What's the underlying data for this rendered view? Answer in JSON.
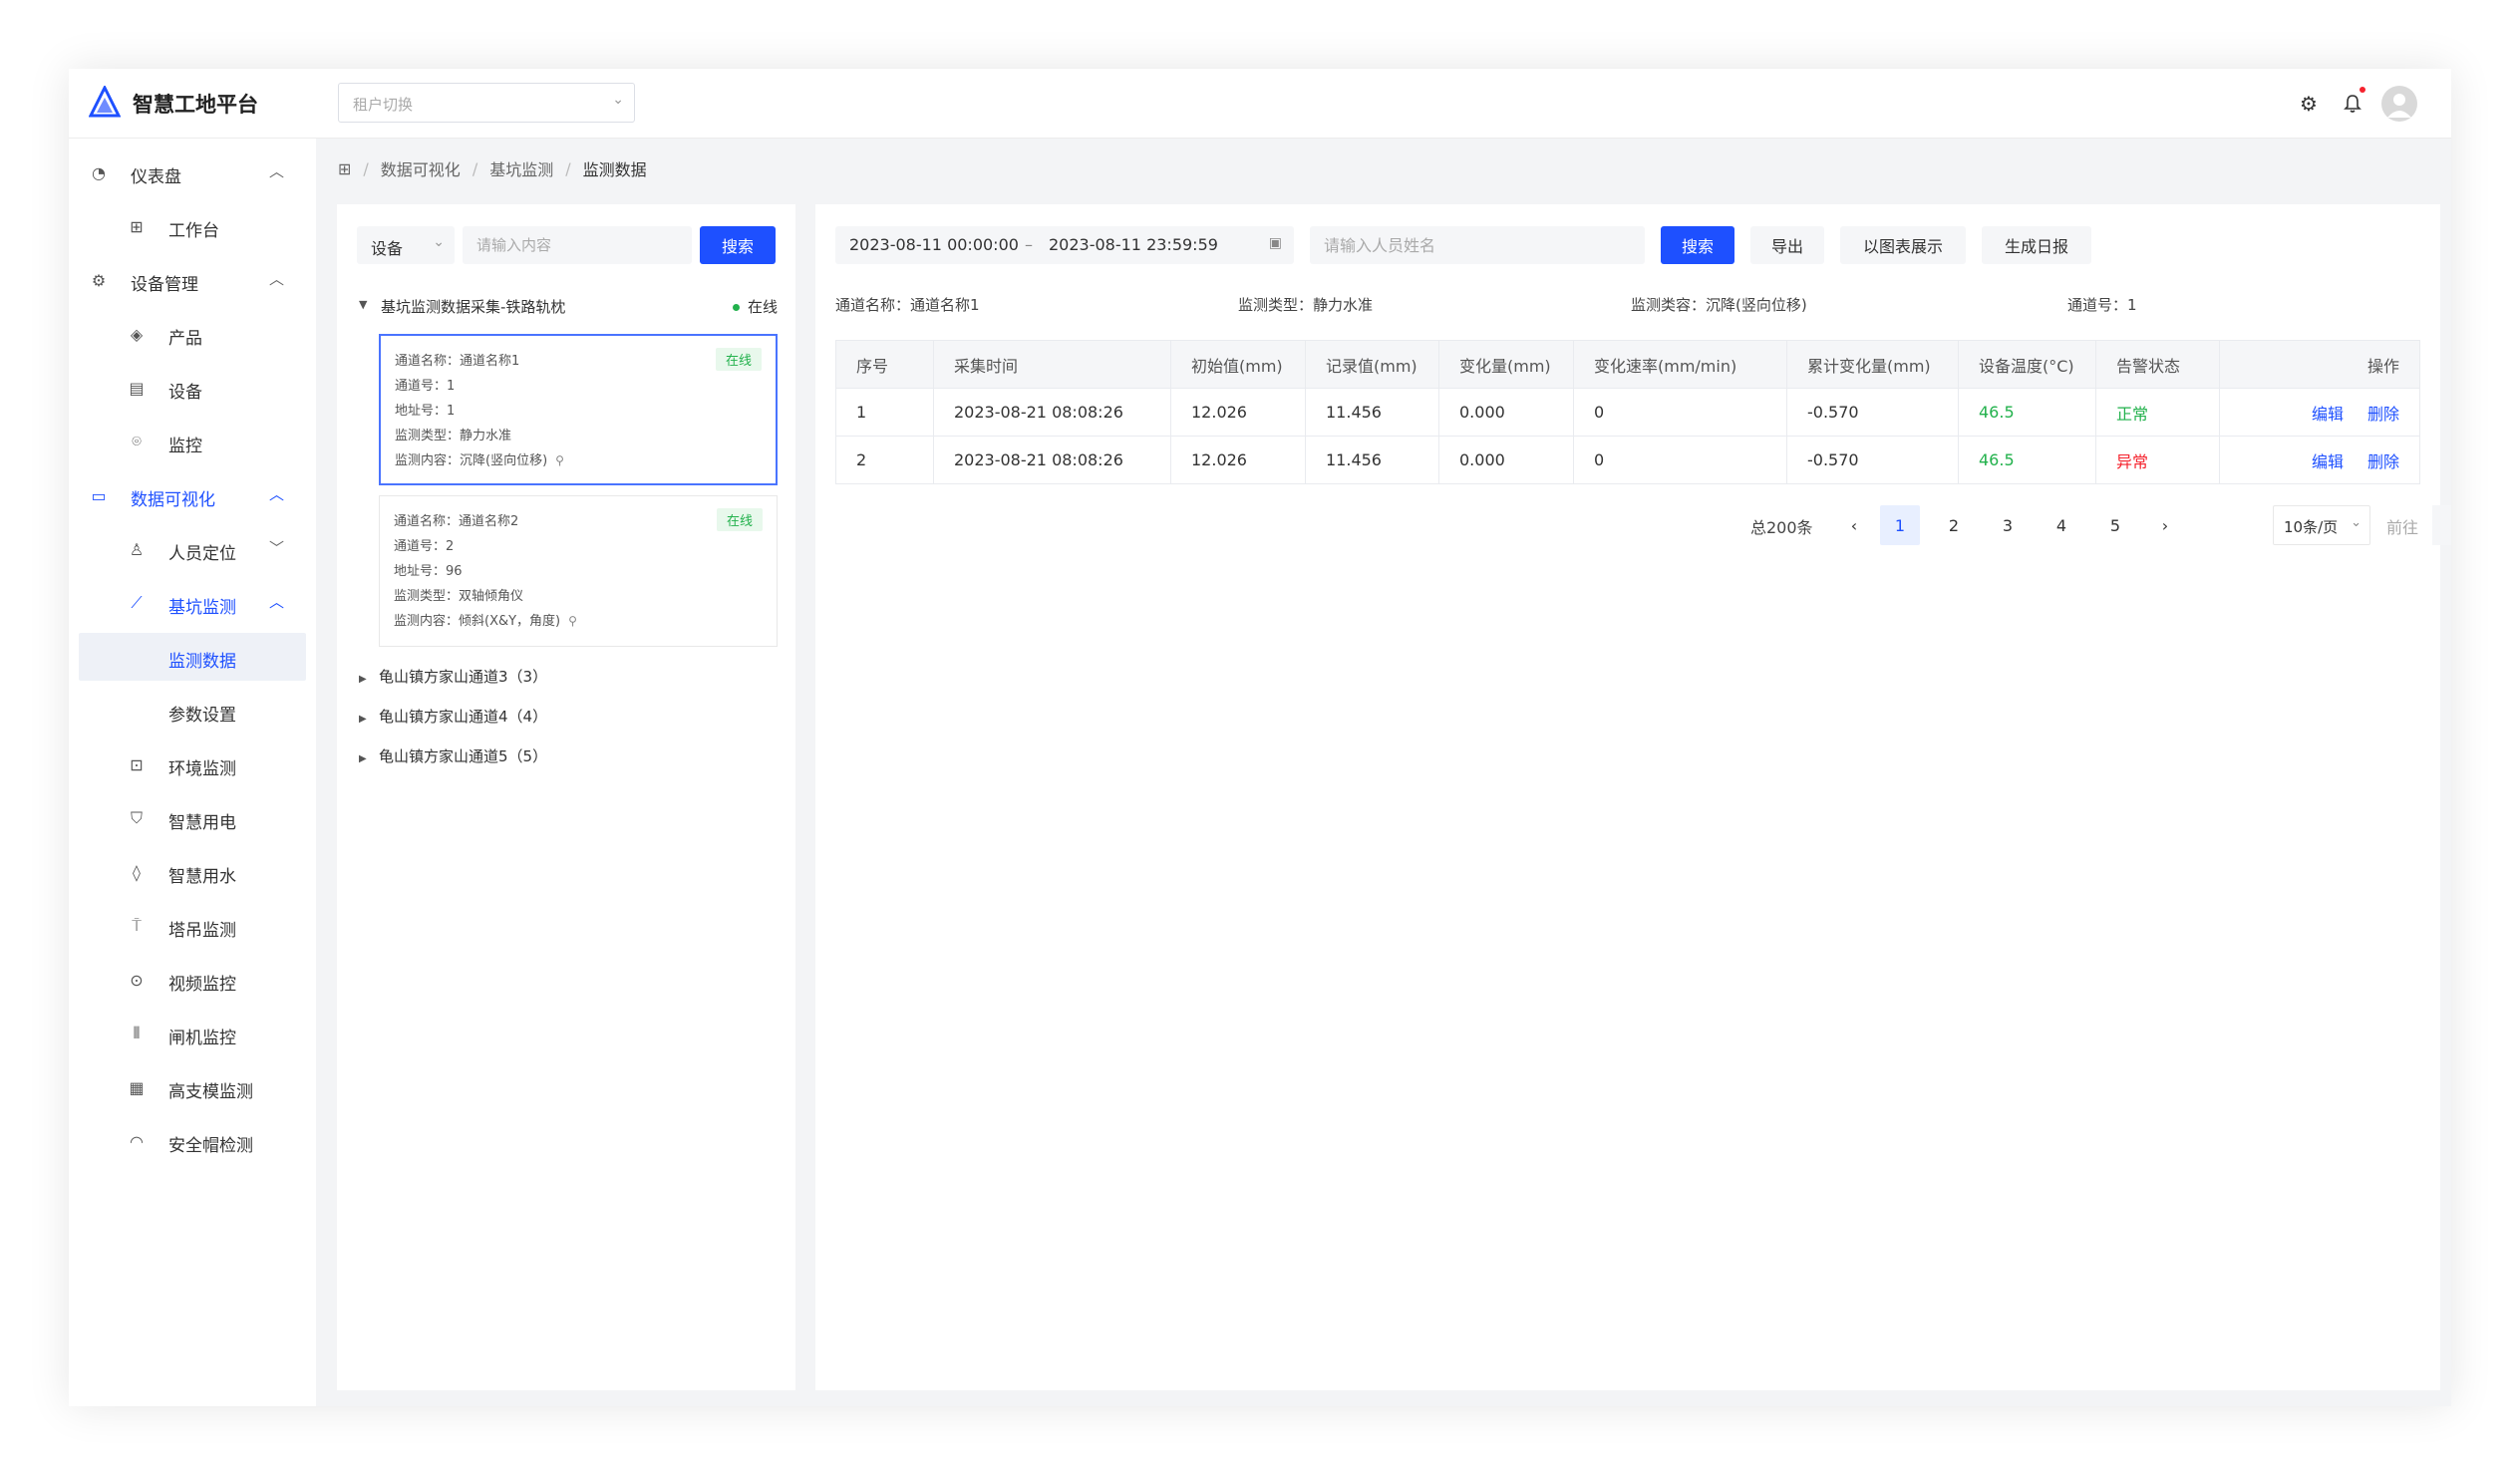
{
  "header": {
    "app_title": "智慧工地平台",
    "tenant_placeholder": "租户切换"
  },
  "sidebar": {
    "items": [
      {
        "label": "仪表盘",
        "level": 1,
        "expanded": true
      },
      {
        "label": "工作台",
        "level": 2
      },
      {
        "label": "设备管理",
        "level": 1,
        "expanded": true
      },
      {
        "label": "产品",
        "level": 2
      },
      {
        "label": "设备",
        "level": 2
      },
      {
        "label": "监控",
        "level": 2
      },
      {
        "label": "数据可视化",
        "level": 1,
        "expanded": true
      },
      {
        "label": "人员定位",
        "level": 2,
        "expanded": false
      },
      {
        "label": "基坑监测",
        "level": 2,
        "expanded": true
      },
      {
        "label": "监测数据",
        "level": 3,
        "active": true
      },
      {
        "label": "参数设置",
        "level": 3
      },
      {
        "label": "环境监测",
        "level": 2
      },
      {
        "label": "智慧用电",
        "level": 2
      },
      {
        "label": "智慧用水",
        "level": 2
      },
      {
        "label": "塔吊监测",
        "level": 2
      },
      {
        "label": "视频监控",
        "level": 2
      },
      {
        "label": "闸机监控",
        "level": 2
      },
      {
        "label": "高支模监测",
        "level": 2
      },
      {
        "label": "安全帽检测",
        "level": 2
      }
    ]
  },
  "breadcrumb": [
    "数据可视化",
    "基坑监测",
    "监测数据"
  ],
  "tree": {
    "select_value": "设备",
    "search_placeholder": "请输入内容",
    "search_button": "搜索",
    "root_label": "基坑监测数据采集-铁路轨枕",
    "root_status": "在线",
    "channels": [
      {
        "name": "通道名称：通道名称1",
        "no": "通道号：1",
        "addr": "地址号：1",
        "type": "监测类型：静力水准",
        "content": "监测内容：沉降(竖向位移)",
        "status": "在线"
      },
      {
        "name": "通道名称：通道名称2",
        "no": "通道号：2",
        "addr": "地址号：96",
        "type": "监测类型：双轴倾角仪",
        "content": "监测内容：倾斜(X&Y，角度)",
        "status": "在线"
      }
    ],
    "nodes": [
      "龟山镇方家山通道3（3）",
      "龟山镇方家山通道4（4）",
      "龟山镇方家山通道5（5）"
    ]
  },
  "filters": {
    "date_start": "2023-08-11 00:00:00",
    "date_sep": "–",
    "date_end": "2023-08-11 23:59:59",
    "name_placeholder": "请输入人员姓名",
    "search_button": "搜索",
    "export_button": "导出",
    "chart_button": "以图表展示",
    "report_button": "生成日报"
  },
  "info": {
    "channel_name": "通道名称：通道名称1",
    "monitor_type": "监测类型：静力水准",
    "monitor_content": "监测类容：沉降(竖向位移)",
    "channel_no": "通道号：1"
  },
  "table": {
    "columns": [
      "序号",
      "采集时间",
      "初始值(mm)",
      "记录值(mm)",
      "变化量(mm)",
      "变化速率(mm/min)",
      "累计变化量(mm)",
      "设备温度(°C)",
      "告警状态",
      "操作"
    ],
    "rows": [
      {
        "idx": "1",
        "time": "2023-08-21 08:08:26",
        "init": "12.026",
        "rec": "11.456",
        "delta": "0.000",
        "rate": "0",
        "cum": "-0.570",
        "temp": "46.5",
        "status": "正常",
        "edit": "编辑",
        "del": "删除"
      },
      {
        "idx": "2",
        "time": "2023-08-21 08:08:26",
        "init": "12.026",
        "rec": "11.456",
        "delta": "0.000",
        "rate": "0",
        "cum": "-0.570",
        "temp": "46.5",
        "status": "异常",
        "edit": "编辑",
        "del": "删除"
      }
    ]
  },
  "pagination": {
    "total": "总200条",
    "pages": [
      "1",
      "2",
      "3",
      "4",
      "5"
    ],
    "current": "1",
    "page_size": "10条/页",
    "goto_label": "前往"
  },
  "colors": {
    "primary": "#1e50ff",
    "success": "#22b14c",
    "danger": "#f5222d"
  }
}
